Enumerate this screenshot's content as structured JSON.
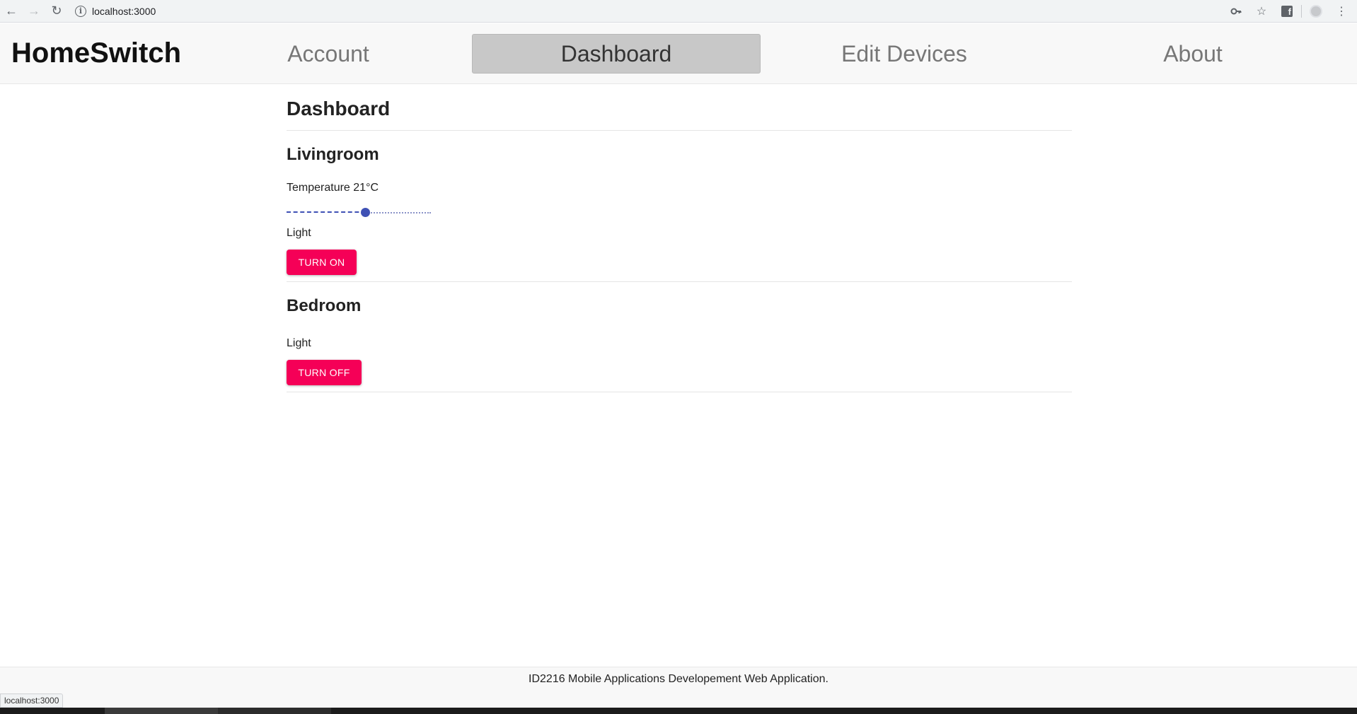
{
  "browser": {
    "url": "localhost:3000",
    "icons": [
      "back-icon",
      "forward-icon",
      "reload-icon",
      "info-icon",
      "key-icon",
      "star-icon",
      "facebook-icon",
      "profile-icon",
      "menu-icon"
    ]
  },
  "header": {
    "brand": "HomeSwitch",
    "nav": [
      {
        "label": "Account",
        "active": false
      },
      {
        "label": "Dashboard",
        "active": true
      },
      {
        "label": "Edit Devices",
        "active": false
      },
      {
        "label": "About",
        "active": false
      }
    ]
  },
  "main": {
    "title": "Dashboard",
    "rooms": [
      {
        "name": "Livingroom",
        "temperature_label": "Temperature 21°C",
        "temperature_slider_fraction": 0.55,
        "light_label": "Light",
        "button_label": "TURN ON"
      },
      {
        "name": "Bedroom",
        "light_label": "Light",
        "button_label": "TURN OFF"
      }
    ]
  },
  "footer": {
    "text": "ID2216 Mobile Applications Developement Web Application."
  },
  "status_bar": {
    "text": "localhost:3000"
  },
  "colors": {
    "accent_button": "#f50057",
    "slider": "#3f51b5",
    "active_nav_bg": "#c8c8c8"
  }
}
